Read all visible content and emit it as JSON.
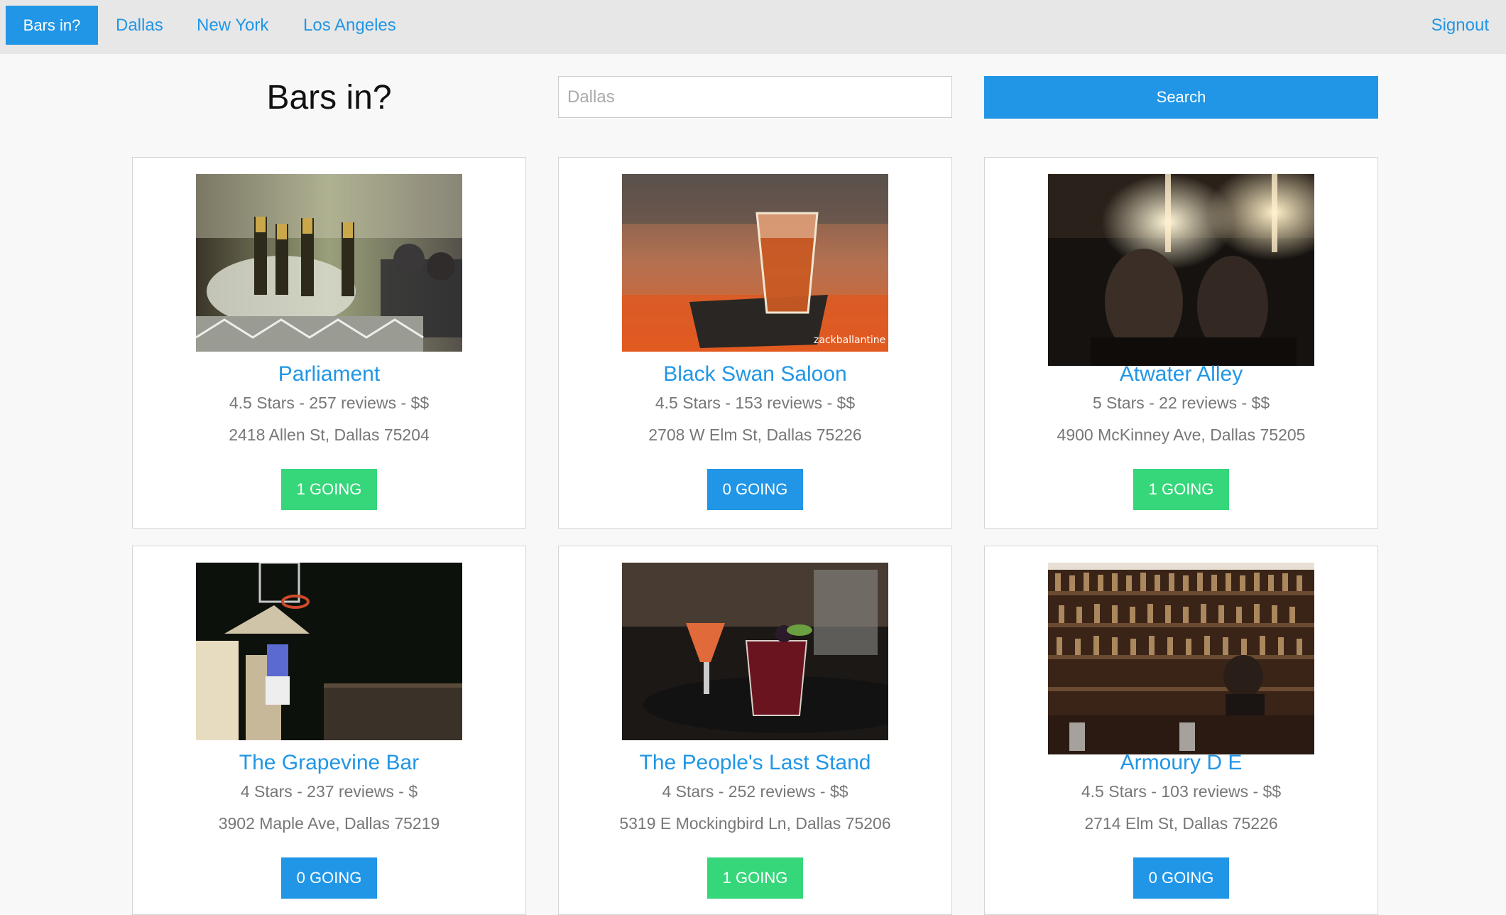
{
  "nav": {
    "brand": "Bars in?",
    "links": [
      "Dallas",
      "New York",
      "Los Angeles"
    ],
    "signout": "Signout"
  },
  "header": {
    "title": "Bars in?",
    "search_placeholder": "Dallas",
    "search_button": "Search"
  },
  "colors": {
    "accent": "#2196e6",
    "going_active": "#36d67a"
  },
  "bars": [
    {
      "name": "Parliament",
      "meta": "4.5 Stars - 257 reviews - $$",
      "address": "2418 Allen St, Dallas 75204",
      "going": "1 GOING",
      "going_color": "#36d67a"
    },
    {
      "name": "Black Swan Saloon",
      "meta": "4.5 Stars - 153 reviews - $$",
      "address": "2708 W Elm St, Dallas 75226",
      "going": "0 GOING",
      "going_color": "#2196e6",
      "photo_caption": "zackballantine"
    },
    {
      "name": "Atwater Alley",
      "meta": "5 Stars - 22 reviews - $$",
      "address": "4900 McKinney Ave, Dallas 75205",
      "going": "1 GOING",
      "going_color": "#36d67a"
    },
    {
      "name": "The Grapevine Bar",
      "meta": "4 Stars - 237 reviews - $",
      "address": "3902 Maple Ave, Dallas 75219",
      "going": "0 GOING",
      "going_color": "#2196e6"
    },
    {
      "name": "The People's Last Stand",
      "meta": "4 Stars - 252 reviews - $$",
      "address": "5319 E Mockingbird Ln, Dallas 75206",
      "going": "1 GOING",
      "going_color": "#36d67a"
    },
    {
      "name": "Armoury D E",
      "meta": "4.5 Stars - 103 reviews - $$",
      "address": "2714 Elm St, Dallas 75226",
      "going": "0 GOING",
      "going_color": "#2196e6"
    }
  ]
}
